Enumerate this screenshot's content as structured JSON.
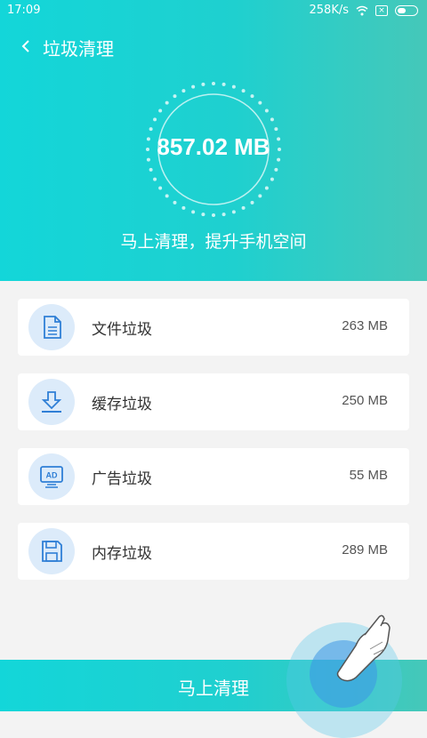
{
  "status_bar": {
    "time": "17:09",
    "speed": "258K/s"
  },
  "header": {
    "title": "垃圾清理",
    "total_size": "857.02 MB",
    "subtitle": "马上清理，提升手机空间"
  },
  "items": [
    {
      "label": "文件垃圾",
      "size": "263 MB",
      "icon": "document-icon"
    },
    {
      "label": "缓存垃圾",
      "size": "250 MB",
      "icon": "download-icon"
    },
    {
      "label": "广告垃圾",
      "size": "55 MB",
      "icon": "ad-monitor-icon"
    },
    {
      "label": "内存垃圾",
      "size": "289 MB",
      "icon": "floppy-disk-icon"
    }
  ],
  "bottom_button": {
    "label": "马上清理"
  },
  "colors": {
    "teal": "#13d6d9",
    "teal_end": "#45c8b9",
    "icon_blue": "#2f7fd6",
    "icon_bg": "#dcebfa"
  }
}
